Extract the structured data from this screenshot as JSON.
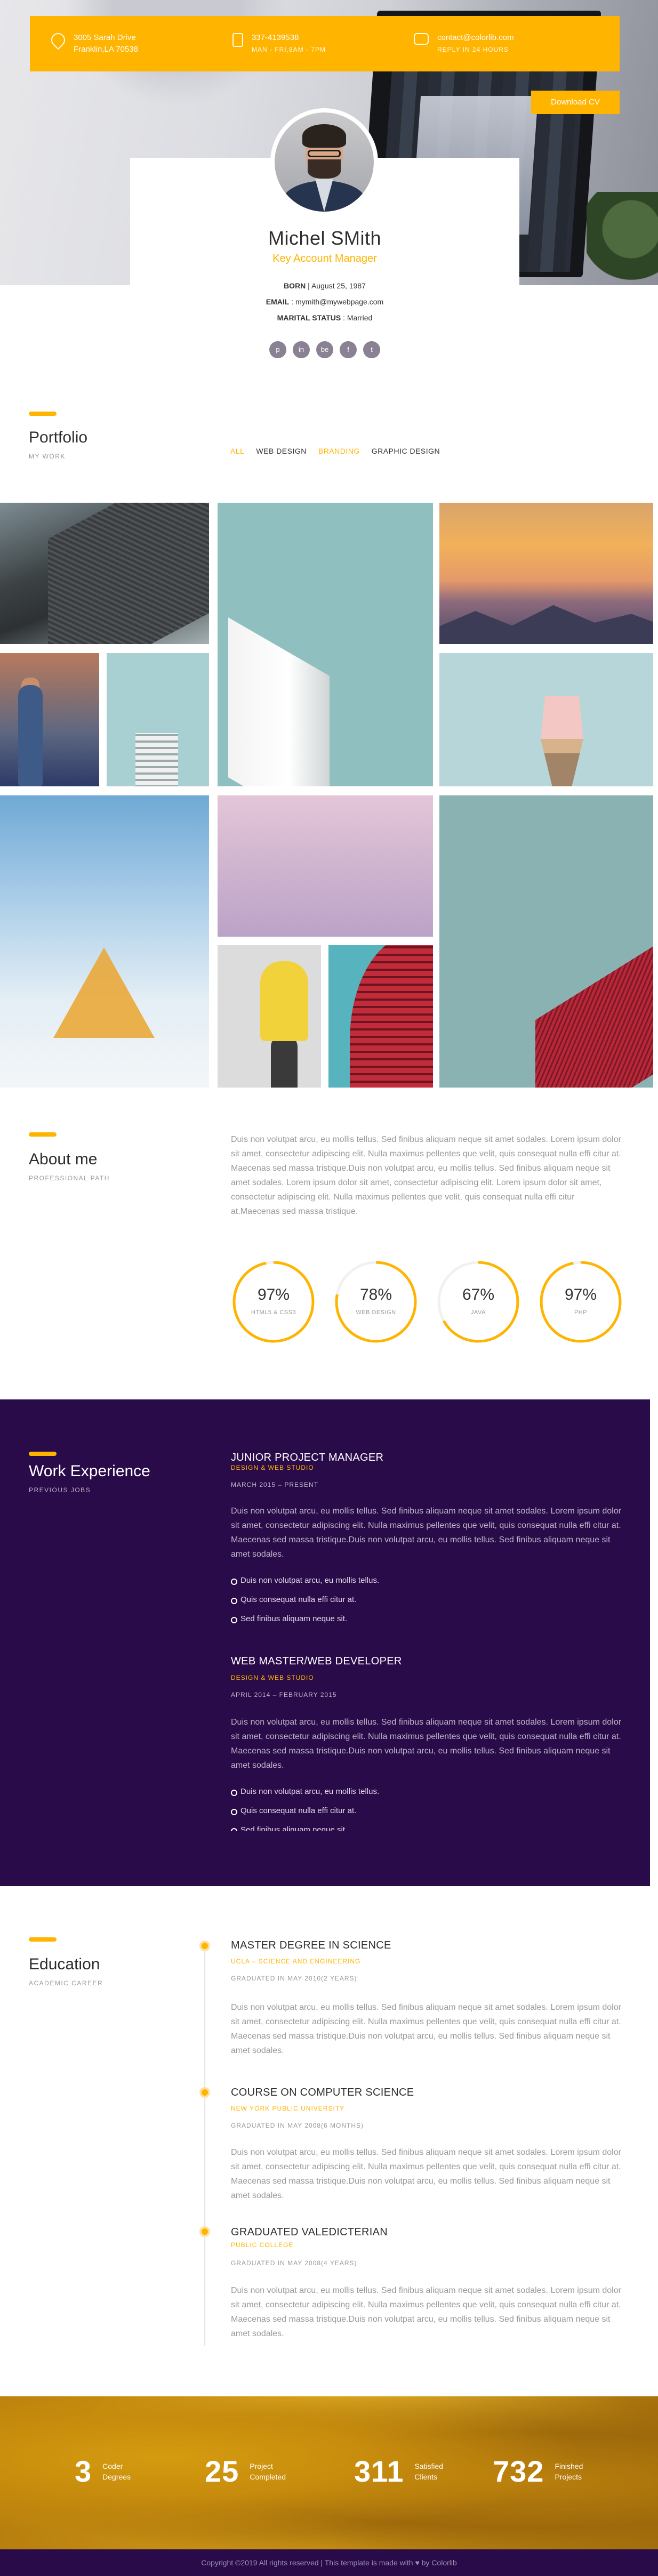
{
  "hero": {
    "contacts": [
      {
        "icon": "map-pin-icon",
        "line1": "3005 Sarah Drive",
        "line2": "Franklin,LA 70538"
      },
      {
        "icon": "phone-icon",
        "line1": "337-4139538",
        "line2": "MAN - FRI,8AM - 7PM"
      },
      {
        "icon": "chat-icon",
        "line1": "contact@colorlib.com",
        "line2": "REPLY IN 24 HOURS"
      }
    ],
    "download_label": "Download CV"
  },
  "profile": {
    "name": "Michel SMith",
    "role": "Key Account Manager",
    "born_label": "BORN",
    "born_value": "August 25, 1987",
    "email_label": "EMAIL",
    "email_value": "mymith@mywebpage.com",
    "marital_label": "MARITAL STATUS",
    "marital_value": "Married",
    "socials": [
      "p",
      "in",
      "be",
      "f",
      "t"
    ]
  },
  "portfolio": {
    "title": "Portfolio",
    "subtitle": "MY WORK",
    "filters": [
      "ALL",
      "WEB DESIGN",
      "BRANDING",
      "GRAPHIC DESIGN"
    ]
  },
  "about": {
    "title": "About me",
    "subtitle": "PROFESSIONAL PATH",
    "text": "Duis non volutpat arcu, eu mollis tellus. Sed finibus aliquam neque sit amet sodales. Lorem ipsum dolor sit amet, consectetur adipiscing elit. Nulla maximus pellentes que velit, quis consequat nulla effi citur at. Maecenas sed massa tristique.Duis non volutpat arcu, eu mollis tellus. Sed finibus aliquam neque sit amet sodales. Lorem ipsum dolor sit amet, consectetur adipiscing elit. Lorem ipsum dolor sit amet, consectetur adipiscing elit. Nulla maximus pellentes que velit, quis consequat nulla effi citur at.Maecenas sed massa tristique.",
    "skills": [
      {
        "value": "97%",
        "percent": 97,
        "label": "HTML5 & CSS3"
      },
      {
        "value": "78%",
        "percent": 78,
        "label": "WEB DESIGN"
      },
      {
        "value": "67%",
        "percent": 67,
        "label": "JAVA"
      },
      {
        "value": "97%",
        "percent": 97,
        "label": "PHP"
      }
    ]
  },
  "work": {
    "title": "Work Experience",
    "subtitle": "PREVIOUS JOBS",
    "jobs": [
      {
        "title": "JUNIOR PROJECT MANAGER",
        "company": "DESIGN & WEB STUDIO",
        "dates": "MARCH 2015 – PRESENT",
        "desc": "Duis non volutpat arcu, eu mollis tellus. Sed finibus aliquam neque sit amet sodales. Lorem ipsum dolor sit amet, consectetur adipiscing elit. Nulla maximus pellentes que velit, quis consequat nulla effi citur at. Maecenas sed massa tristique.Duis non volutpat arcu, eu mollis tellus. Sed finibus aliquam neque sit amet sodales.",
        "bullets": [
          "Duis non volutpat arcu, eu mollis tellus.",
          "Quis consequat nulla effi citur at.",
          "Sed finibus aliquam neque sit."
        ]
      },
      {
        "title": "WEB MASTER/WEB DEVELOPER",
        "company": "DESIGN & WEB STUDIO",
        "dates": "APRIL 2014 – FEBRUARY 2015",
        "desc": "Duis non volutpat arcu, eu mollis tellus. Sed finibus aliquam neque sit amet sodales. Lorem ipsum dolor sit amet, consectetur adipiscing elit. Nulla maximus pellentes que velit, quis consequat nulla effi citur at. Maecenas sed massa tristique.Duis non volutpat arcu, eu mollis tellus. Sed finibus aliquam neque sit amet sodales.",
        "bullets": [
          "Duis non volutpat arcu, eu mollis tellus.",
          "Quis consequat nulla effi citur at.",
          "Sed finibus aliquam neque sit."
        ]
      }
    ]
  },
  "education": {
    "title": "Education",
    "subtitle": "ACADEMIC CAREER",
    "items": [
      {
        "title": "MASTER DEGREE IN SCIENCE",
        "school": "UCLA – SCIENCE AND ENGINEERING",
        "meta": "GRADUATED IN MAY 2010(2 YEARS)",
        "desc": "Duis non volutpat arcu, eu mollis tellus. Sed finibus aliquam neque sit amet sodales. Lorem ipsum dolor sit amet, consectetur adipiscing elit. Nulla maximus pellentes que velit, quis consequat nulla effi citur at. Maecenas sed massa tristique.Duis non volutpat arcu, eu mollis tellus. Sed finibus aliquam neque sit amet sodales."
      },
      {
        "title": "COURSE ON COMPUTER SCIENCE",
        "school": "NEW YORK PUBLIC UNIVERSITY",
        "meta": "GRADUATED IN MAY 2008(6 MONTHS)",
        "desc": "Duis non volutpat arcu, eu mollis tellus. Sed finibus aliquam neque sit amet sodales. Lorem ipsum dolor sit amet, consectetur adipiscing elit. Nulla maximus pellentes que velit, quis consequat nulla effi citur at. Maecenas sed massa tristique.Duis non volutpat arcu, eu mollis tellus. Sed finibus aliquam neque sit amet sodales."
      },
      {
        "title": "GRADUATED VALEDICTERIAN",
        "school": "PUBLIC COLLEGE",
        "meta": "GRADUATED IN MAY 2008(4 YEARS)",
        "desc": "Duis non volutpat arcu, eu mollis tellus. Sed finibus aliquam neque sit amet sodales. Lorem ipsum dolor sit amet, consectetur adipiscing elit. Nulla maximus pellentes que velit, quis consequat nulla effi citur at. Maecenas sed massa tristique.Duis non volutpat arcu, eu mollis tellus. Sed finibus aliquam neque sit amet sodales."
      }
    ]
  },
  "counters": [
    {
      "num": "3",
      "label": "Coder Degrees"
    },
    {
      "num": "25",
      "label": "Project Completed"
    },
    {
      "num": "311",
      "label": "Satisfied Clients"
    },
    {
      "num": "732",
      "label": "Finished Projects"
    }
  ],
  "footer": {
    "pre": "Copyright ©2019 All rights reserved | This template is made with",
    "heart": "♥",
    "post": "by Colorlib"
  },
  "colors": {
    "accent": "#ffb400",
    "dark_purple": "#2a0b4a",
    "muted_text": "#999999"
  }
}
